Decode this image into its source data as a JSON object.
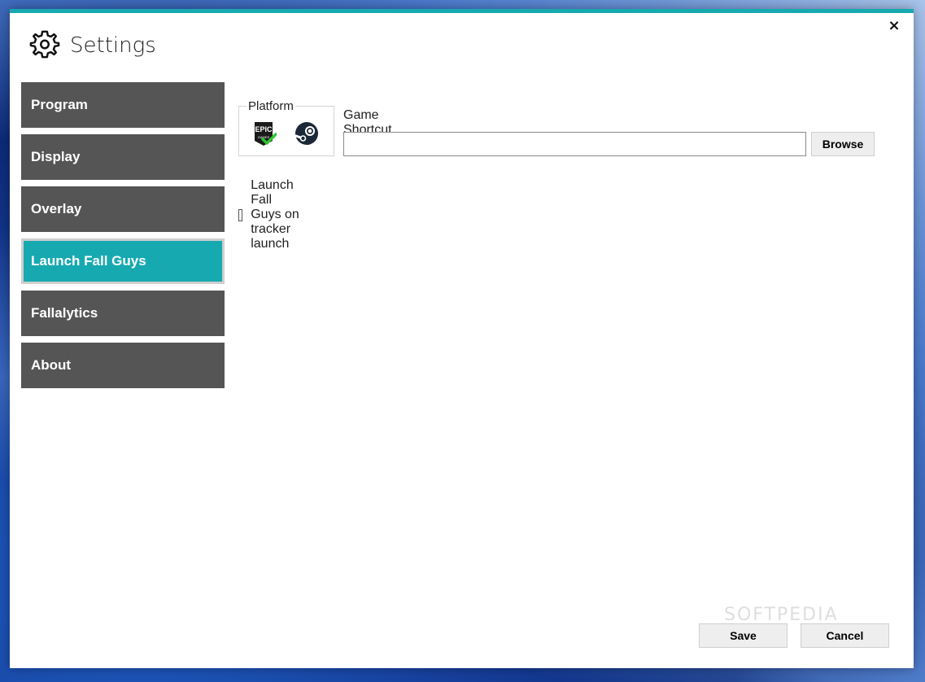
{
  "window": {
    "title": "Settings",
    "close_glyph": "×",
    "accent_color": "#17a9b0"
  },
  "sidebar": {
    "items": [
      {
        "label": "Program",
        "active": false
      },
      {
        "label": "Display",
        "active": false
      },
      {
        "label": "Overlay",
        "active": false
      },
      {
        "label": "Launch Fall Guys",
        "active": true
      },
      {
        "label": "Fallalytics",
        "active": false
      },
      {
        "label": "About",
        "active": false
      }
    ]
  },
  "launch": {
    "platform_label": "Platform",
    "platforms": [
      {
        "icon": "epic-games-icon",
        "selected": true
      },
      {
        "icon": "steam-icon",
        "selected": false
      }
    ],
    "shortcut_label": "Game Shortcut Location",
    "shortcut_value": "",
    "browse_label": "Browse",
    "launch_checkbox_label": "Launch Fall Guys on tracker launch",
    "launch_checked": false
  },
  "footer": {
    "save_label": "Save",
    "cancel_label": "Cancel"
  },
  "watermark": "SOFTPEDIA"
}
